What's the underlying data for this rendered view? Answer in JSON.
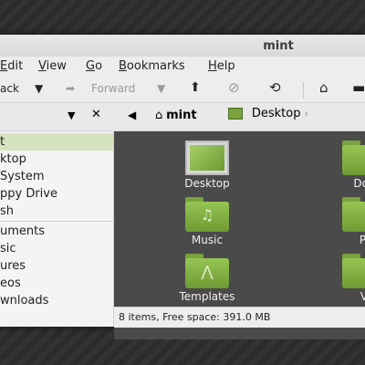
{
  "window": {
    "title": "mint"
  },
  "menubar": {
    "edit": {
      "prefix": "",
      "u": "E",
      "rest": "dit"
    },
    "view": {
      "u": "V",
      "rest": "iew"
    },
    "go": {
      "u": "G",
      "rest": "o"
    },
    "bookmarks": {
      "u": "B",
      "rest": "ookmarks"
    },
    "help": {
      "u": "H",
      "rest": "elp"
    }
  },
  "toolbar": {
    "back_label": "ack",
    "forward_label": "Forward"
  },
  "pathbar": {
    "home_label": "mint",
    "current_label": "Desktop"
  },
  "sidebar": {
    "items": [
      "t",
      "ktop",
      "System",
      "ppy Drive",
      "sh",
      "uments",
      "sic",
      "ures",
      "eos",
      "wnloads"
    ]
  },
  "content": {
    "files": [
      {
        "label": "Desktop",
        "icon": "desktop-icon"
      },
      {
        "label": "Doc",
        "icon": "folder-icon"
      },
      {
        "label": "Music",
        "icon": "music-folder-icon"
      },
      {
        "label": "Pi",
        "icon": "folder-icon"
      },
      {
        "label": "Templates",
        "icon": "templates-folder-icon"
      },
      {
        "label": "V",
        "icon": "folder-icon"
      }
    ]
  },
  "status": {
    "text": "8 items, Free space: 391.0 MB"
  },
  "colors": {
    "accent": "#7aa23f",
    "selection": "#d6e3c0",
    "content_bg": "#4a4a4a"
  }
}
